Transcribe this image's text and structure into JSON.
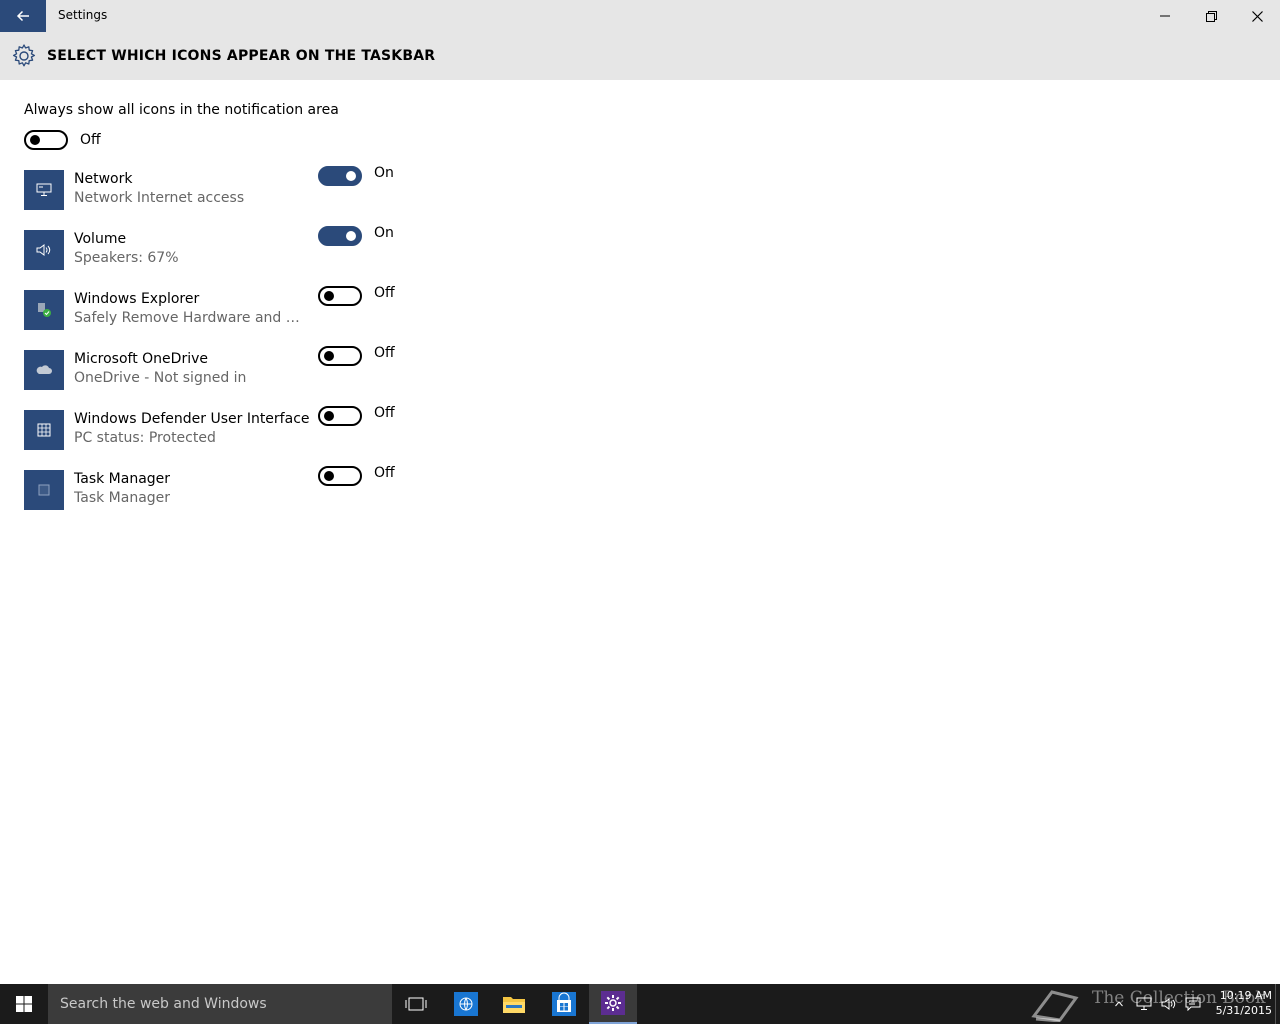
{
  "window": {
    "title": "Settings"
  },
  "header": {
    "title": "SELECT WHICH ICONS APPEAR ON THE TASKBAR",
    "icon": "gear-icon"
  },
  "always_show": {
    "label": "Always show all icons in the notification area",
    "state": "Off",
    "on": false
  },
  "apps": [
    {
      "name": "Network",
      "desc": "Network Internet access",
      "state": "On",
      "on": true,
      "icon": "network-icon"
    },
    {
      "name": "Volume",
      "desc": "Speakers: 67%",
      "state": "On",
      "on": true,
      "icon": "volume-icon"
    },
    {
      "name": "Windows Explorer",
      "desc": "Safely Remove Hardware and Eje...",
      "state": "Off",
      "on": false,
      "icon": "usb-eject-icon"
    },
    {
      "name": "Microsoft OneDrive",
      "desc": "OneDrive - Not signed in",
      "state": "Off",
      "on": false,
      "icon": "onedrive-icon"
    },
    {
      "name": "Windows Defender User Interface",
      "desc": "PC status: Protected",
      "state": "Off",
      "on": false,
      "icon": "defender-icon"
    },
    {
      "name": "Task Manager",
      "desc": "Task Manager",
      "state": "Off",
      "on": false,
      "icon": "task-manager-icon"
    }
  ],
  "taskbar": {
    "search_placeholder": "Search the web and Windows",
    "watermark": "The Collection Book",
    "clock_time": "10:19 AM",
    "clock_date": "5/31/2015"
  },
  "colors": {
    "accent": "#2b4a7a",
    "header_bg": "#e6e6e6",
    "taskbar_bg": "#1b1b1b"
  }
}
